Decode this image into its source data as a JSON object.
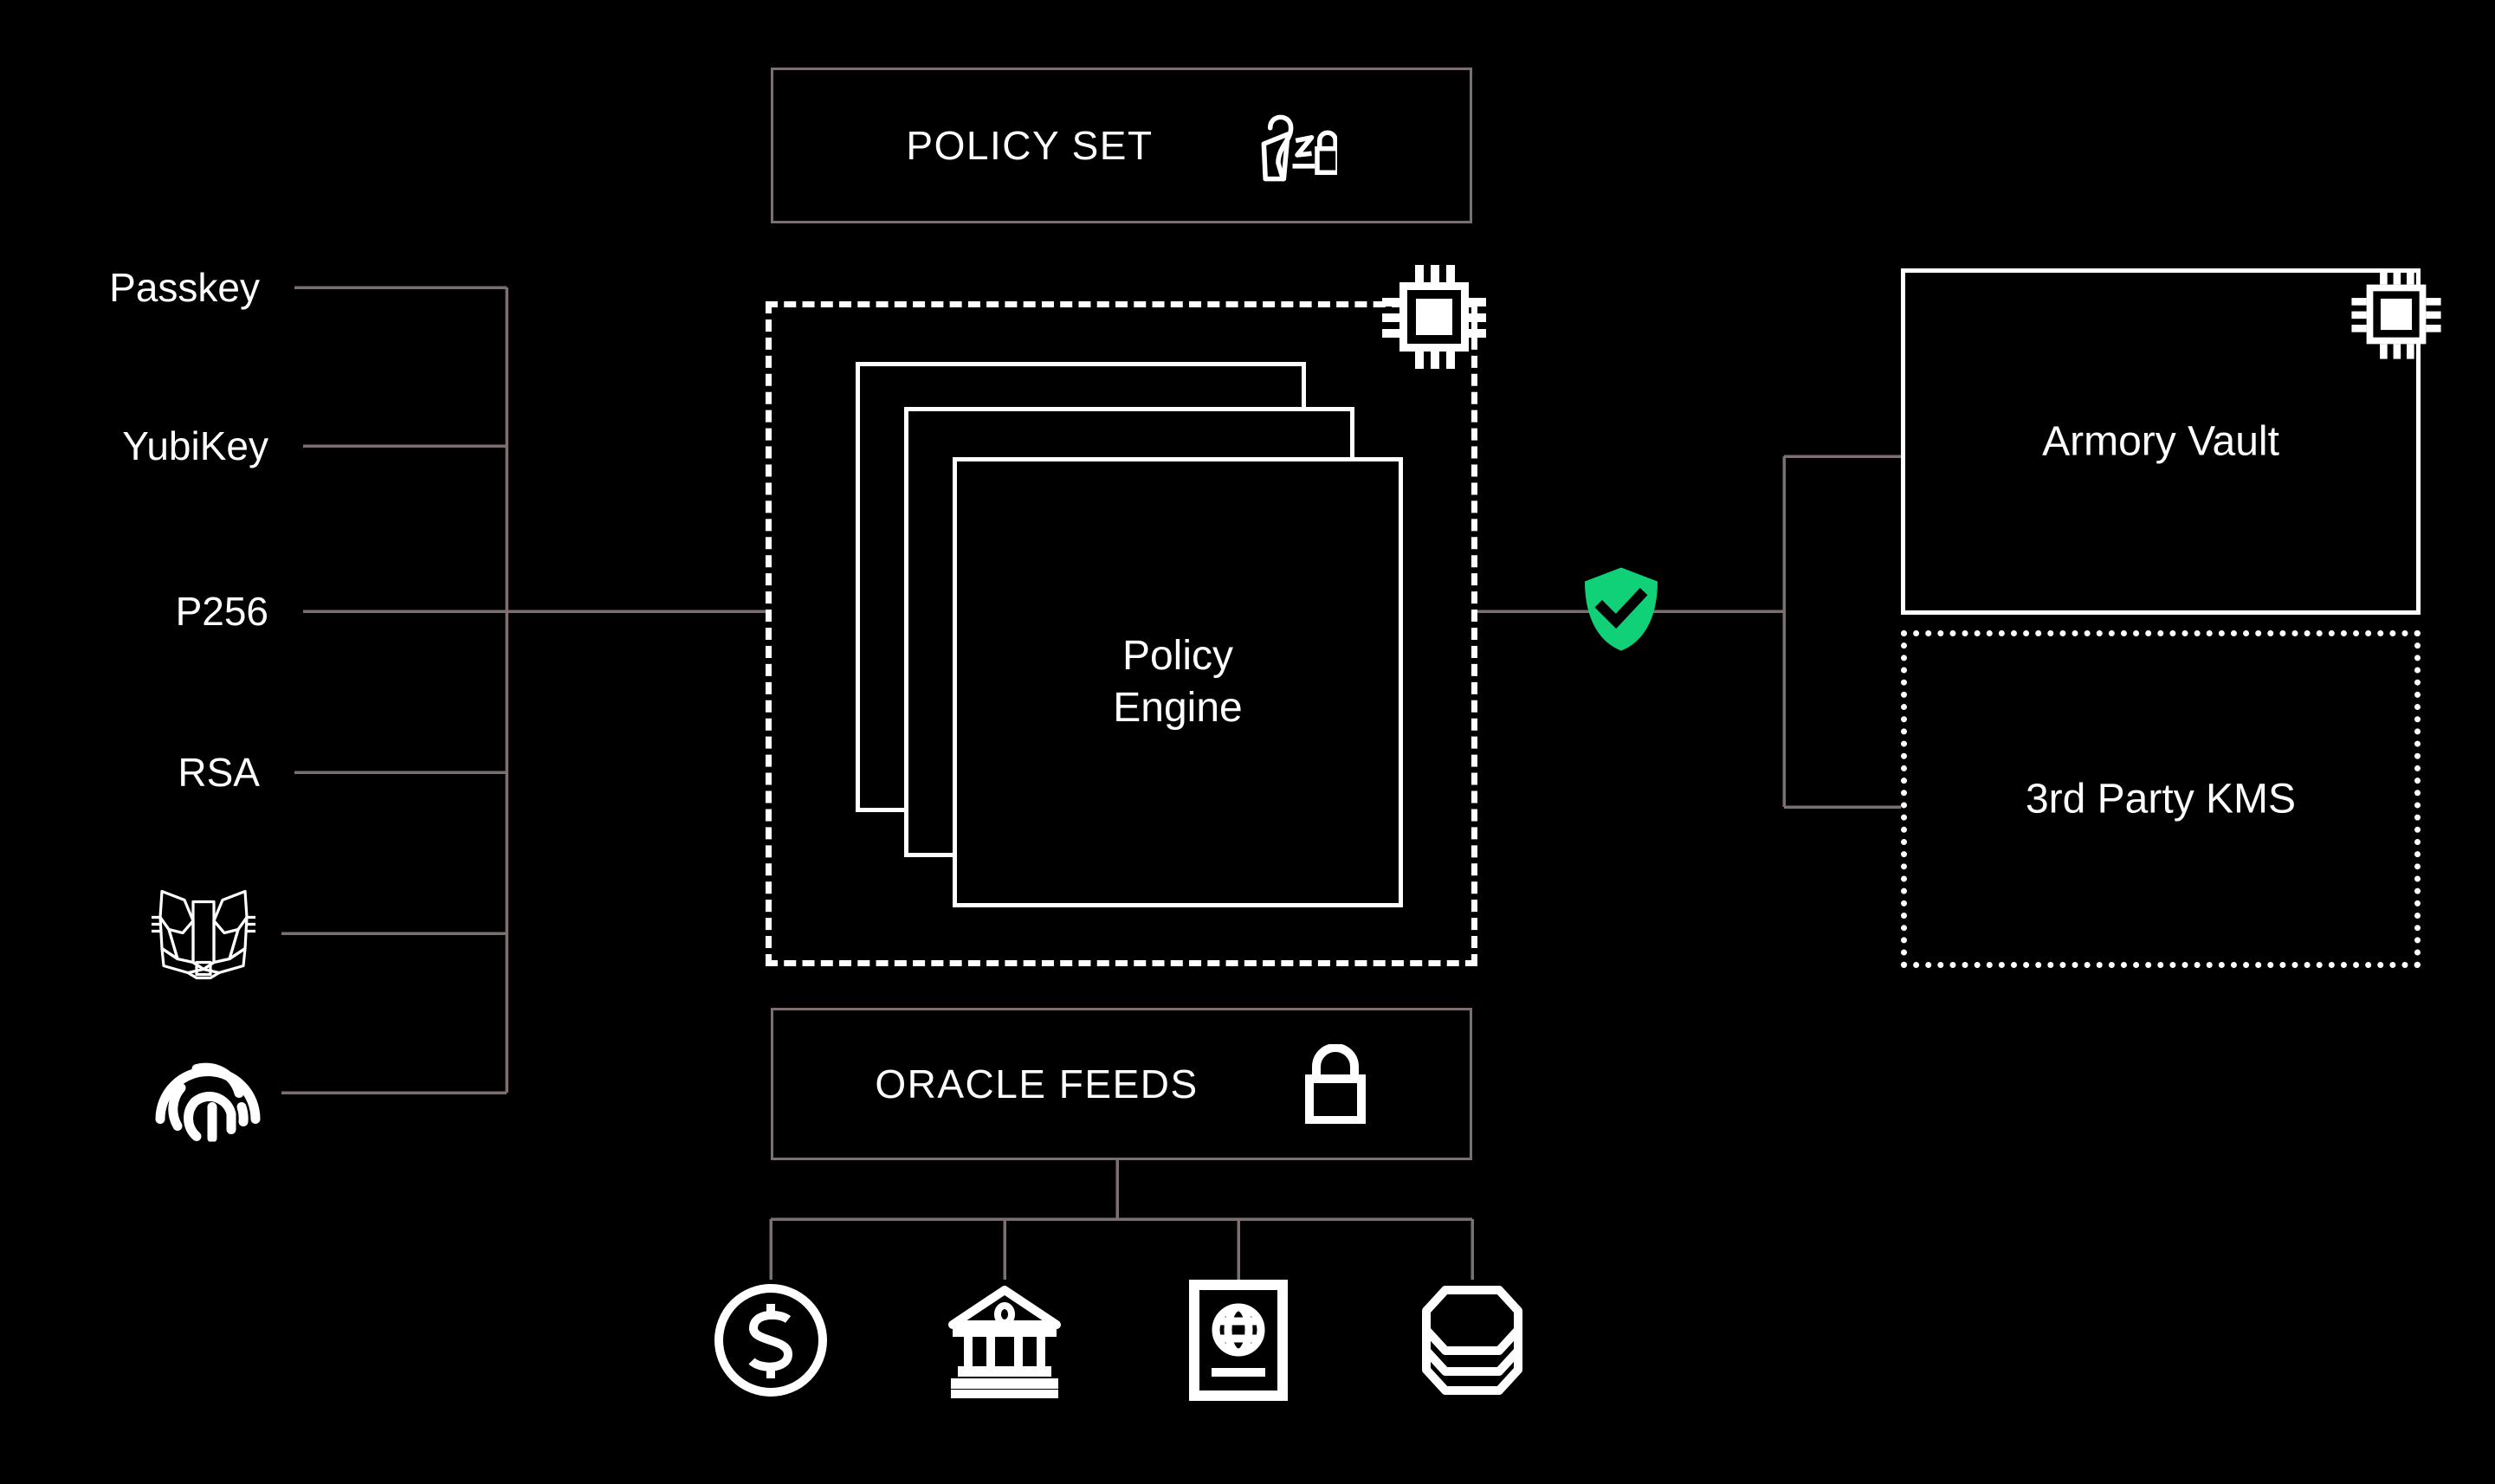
{
  "theme": {
    "background": "#000000",
    "wire": "#7d6f6f",
    "stroke_white": "#ffffff",
    "accent_green": "#11d178",
    "text": "#ffffff"
  },
  "policy_set": {
    "label": "POLICY SET",
    "icon": "policy-signature-lock-icon"
  },
  "policy_engine": {
    "label_line1": "Policy",
    "label_line2": "Engine",
    "card_count": 3,
    "enclosure_style": "dashed",
    "chip_icon": "microchip-icon"
  },
  "credentials": {
    "items": [
      {
        "label": "Passkey",
        "icon": null,
        "type": "text"
      },
      {
        "label": "YubiKey",
        "icon": null,
        "type": "text"
      },
      {
        "label": "P256",
        "icon": null,
        "type": "text"
      },
      {
        "label": "RSA",
        "icon": null,
        "type": "text"
      },
      {
        "label": "MetaMask",
        "icon": "metamask-fox-icon",
        "type": "icon"
      },
      {
        "label": "Biometric",
        "icon": "fingerprint-icon",
        "type": "icon"
      }
    ]
  },
  "verification": {
    "icon": "shield-check-icon",
    "color": "#11d178"
  },
  "vaults": {
    "items": [
      {
        "label": "Armory Vault",
        "border": "solid",
        "icon": "microchip-icon"
      },
      {
        "label": "3rd Party KMS",
        "border": "dotted",
        "icon": null
      }
    ]
  },
  "oracle_feeds": {
    "label": "ORACLE FEEDS",
    "icon": "padlock-icon",
    "sources": [
      {
        "name": "price-feed",
        "icon": "dollar-circle-icon"
      },
      {
        "name": "bank-feed",
        "icon": "bank-institution-icon"
      },
      {
        "name": "identity-feed",
        "icon": "passport-globe-icon"
      },
      {
        "name": "data-store-feed",
        "icon": "database-stack-icon"
      }
    ]
  }
}
